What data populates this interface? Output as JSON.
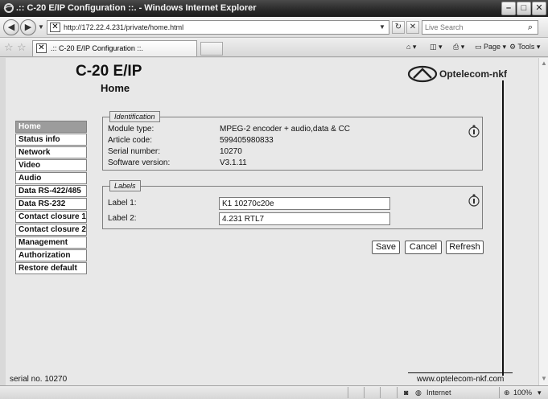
{
  "window": {
    "title": ".:: C-20 E/IP Configuration ::. - Windows Internet Explorer"
  },
  "addressbar": {
    "url": "http://172.22.4.231/private/home.html",
    "search_placeholder": "Live Search"
  },
  "tab": {
    "label": ".:: C-20 E/IP Configuration ::."
  },
  "toolbar": {
    "page_label": "Page",
    "tools_label": "Tools"
  },
  "page": {
    "product_title": "C-20 E/IP",
    "heading": "Home",
    "logo_text": "Optelecom-nkf"
  },
  "menu": [
    {
      "label": "Home",
      "active": true
    },
    {
      "label": "Status info",
      "active": false
    },
    {
      "label": "Network",
      "active": false
    },
    {
      "label": "Video",
      "active": false
    },
    {
      "label": "Audio",
      "active": false
    },
    {
      "label": "Data RS-422/485",
      "active": false
    },
    {
      "label": "Data RS-232",
      "active": false
    },
    {
      "label": "Contact closure 1",
      "active": false
    },
    {
      "label": "Contact closure 2",
      "active": false
    },
    {
      "label": "Management",
      "active": false
    },
    {
      "label": "Authorization",
      "active": false
    },
    {
      "label": "Restore default",
      "active": false
    }
  ],
  "identification": {
    "legend": "Identification",
    "rows": [
      {
        "label": "Module type:",
        "value": "MPEG-2 encoder + audio,data & CC"
      },
      {
        "label": "Article code:",
        "value": "599405980833"
      },
      {
        "label": "Serial number:",
        "value": "10270"
      },
      {
        "label": "Software version:",
        "value": "V3.1.11"
      }
    ]
  },
  "labels": {
    "legend": "Labels",
    "label1": {
      "label": "Label 1:",
      "value": "K1 10270c20e"
    },
    "label2": {
      "label": "Label 2:",
      "value": "4.231 RTL7"
    }
  },
  "buttons": {
    "save": "Save",
    "cancel": "Cancel",
    "refresh": "Refresh"
  },
  "footer": {
    "serial": "serial no. 10270",
    "website": "www.optelecom-nkf.com"
  },
  "statusbar": {
    "zone": "Internet",
    "zoom": "100%"
  }
}
